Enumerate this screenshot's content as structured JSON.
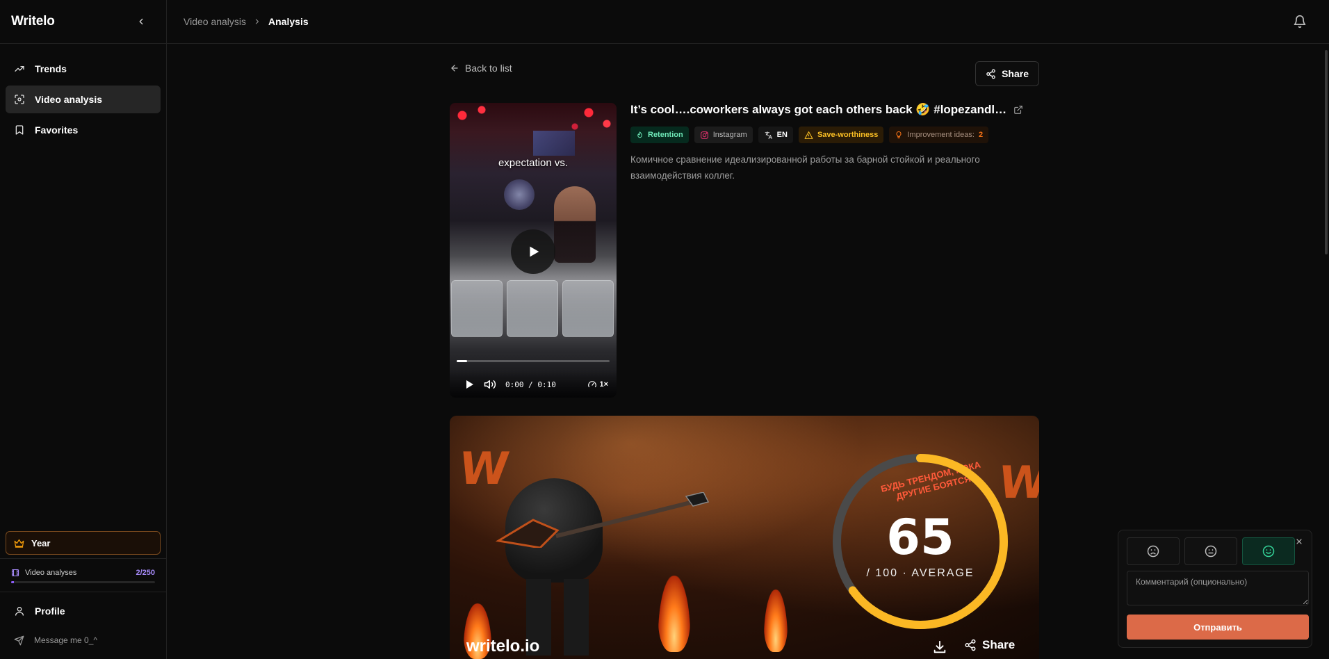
{
  "sidebar": {
    "brand": "Writelo",
    "items": [
      {
        "label": "Trends",
        "icon": "trending-up-icon"
      },
      {
        "label": "Video analysis",
        "icon": "scan-icon",
        "active": true
      },
      {
        "label": "Favorites",
        "icon": "bookmark-icon"
      }
    ],
    "plan_label": "Year",
    "usage": {
      "label": "Video analyses",
      "count": "2/250",
      "used_fraction": 0.008
    },
    "profile_label": "Profile",
    "message_label": "Message me 0_^"
  },
  "header": {
    "breadcrumb": [
      "Video analysis",
      "Analysis"
    ]
  },
  "main": {
    "back_label": "Back to list",
    "share_label": "Share",
    "video": {
      "caption": "expectation vs.",
      "time": "0:00 / 0:10",
      "speed": "1×",
      "progress_fraction": 0.07
    },
    "title": "It’s cool….coworkers always got each others back 🤣 #lopezandl…",
    "tags": {
      "retention": "Retention",
      "platform": "Instagram",
      "language": "EN",
      "save": "Save-worthiness",
      "improvement_label": "Improvement ideas:",
      "improvement_count": "2"
    },
    "description": "Комичное сравнение идеализированной работы за барной стойкой и реального взаимодействия коллег.",
    "banner": {
      "score": "65",
      "score_sub": "/ 100 · AVERAGE",
      "score_fraction": 0.65,
      "slogan": "БУДЬ ТРЕНДОМ, ПОКА ДРУГИЕ БОЯТСЯ",
      "brand": "writelo.io",
      "share_label": "Share",
      "ring_color": "#fbb824",
      "track_color": "#4a4a4a"
    }
  },
  "feedback": {
    "faces": [
      "sad-face-icon",
      "neutral-face-icon",
      "happy-face-icon"
    ],
    "selected": 2,
    "placeholder": "Комментарий (опционально)",
    "submit_label": "Отправить"
  },
  "colors": {
    "accent_orange": "#dc6a48",
    "retention_green": "#6ee7b7",
    "save_yellow": "#fbbf24",
    "usage_purple": "#8b5cf6"
  }
}
